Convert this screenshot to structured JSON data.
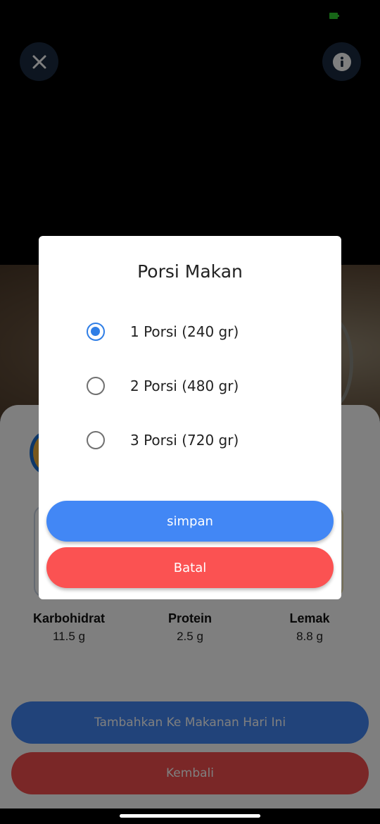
{
  "colors": {
    "primary": "#4287f5",
    "danger": "#fb5252",
    "radio_selected": "#2f7ee6"
  },
  "top_bar": {
    "close_icon": "close-icon",
    "info_icon": "info-icon"
  },
  "nutrition": {
    "items": [
      {
        "name": "Karbohidrat",
        "value": "11.5 g"
      },
      {
        "name": "Protein",
        "value": "2.5 g"
      },
      {
        "name": "Lemak",
        "value": "8.8 g"
      }
    ]
  },
  "actions": {
    "add_label": "Tambahkan Ke Makanan Hari Ini",
    "back_label": "Kembali"
  },
  "dialog": {
    "title": "Porsi Makan",
    "options": [
      {
        "label": "1 Porsi (240 gr)",
        "selected": true
      },
      {
        "label": "2 Porsi (480 gr)",
        "selected": false
      },
      {
        "label": "3 Porsi (720 gr)",
        "selected": false
      }
    ],
    "save_label": "simpan",
    "cancel_label": "Batal"
  }
}
